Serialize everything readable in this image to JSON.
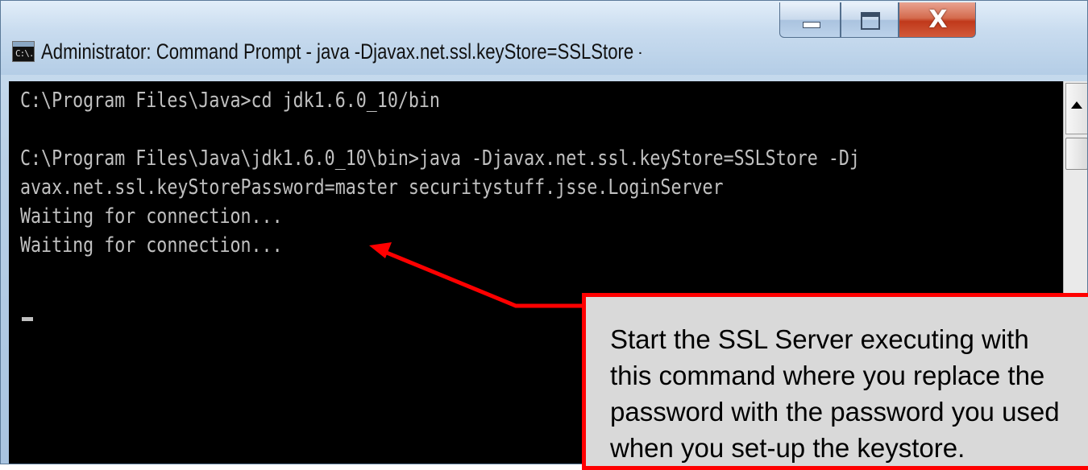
{
  "window": {
    "title": "Administrator: Command Prompt - java  -Djavax.net.ssl.keyStore=SSLStore -Djavax.net.ssl.keyStoreP...",
    "icon": "command-prompt-icon",
    "icon_text": "C:\\."
  },
  "caption_buttons": {
    "minimize": "minimize-icon",
    "maximize": "maximize-icon",
    "close": "X"
  },
  "console": {
    "lines": [
      "C:\\Program Files\\Java>cd jdk1.6.0_10/bin",
      "",
      "C:\\Program Files\\Java\\jdk1.6.0_10\\bin>java -Djavax.net.ssl.keyStore=SSLStore -Dj",
      "avax.net.ssl.keyStorePassword=master securitystuff.jsse.LoginServer",
      "Waiting for connection...",
      "Waiting for connection..."
    ],
    "background": "#000000",
    "foreground": "#c0c0c0"
  },
  "callout": {
    "lines": [
      "Start the SSL Server executing with",
      "this command where you replace the",
      "password with the password you used",
      "when you set-up the keystore."
    ],
    "border_color": "#ff0000",
    "background": "#d9d9d9",
    "arrow_color": "#ff0000"
  }
}
